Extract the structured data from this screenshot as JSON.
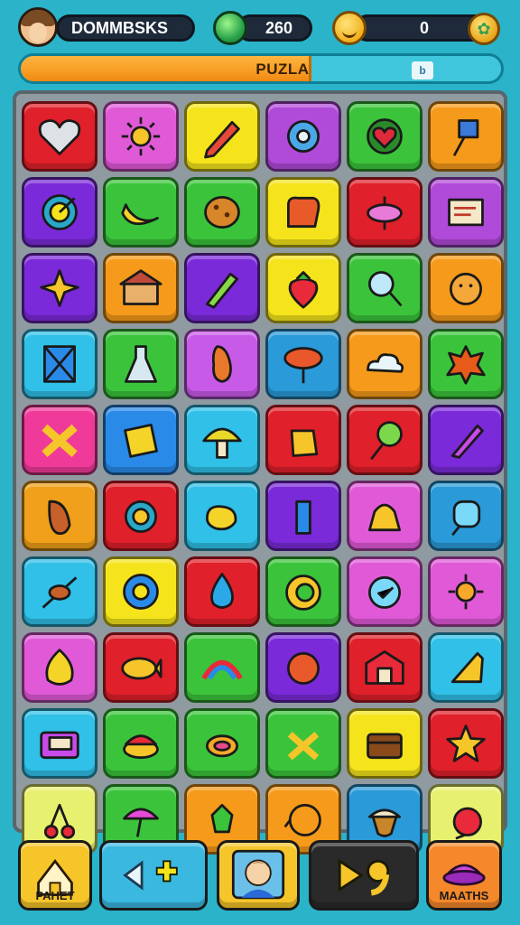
{
  "hud": {
    "player_name": "DOMMBSKS",
    "gems": "260",
    "coins": "0",
    "progress_label": "PUZLA",
    "progress_fraction": 0.6,
    "progress_chip": "b"
  },
  "board": {
    "tiles": [
      {
        "icon": "heart-shield-icon",
        "bg": "#e0202a"
      },
      {
        "icon": "sun-icon",
        "bg": "#e05ad8"
      },
      {
        "icon": "pen-icon",
        "bg": "#f5e41c"
      },
      {
        "icon": "gear-icon",
        "bg": "#b04ad8"
      },
      {
        "icon": "heart-leaf-icon",
        "bg": "#3bc43b"
      },
      {
        "icon": "tool-icon",
        "bg": "#f59a1a"
      },
      {
        "icon": "target-icon",
        "bg": "#7a2ad8"
      },
      {
        "icon": "banana-icon",
        "bg": "#3bc43b"
      },
      {
        "icon": "cookie-icon",
        "bg": "#3bc43b"
      },
      {
        "icon": "glove-icon",
        "bg": "#f5e41c"
      },
      {
        "icon": "spinner-icon",
        "bg": "#e0202a"
      },
      {
        "icon": "note-icon",
        "bg": "#b04ad8"
      },
      {
        "icon": "star-fish-icon",
        "bg": "#7a2ad8"
      },
      {
        "icon": "house-icon",
        "bg": "#f59a1a"
      },
      {
        "icon": "pencil-icon",
        "bg": "#7a2ad8"
      },
      {
        "icon": "strawberry-icon",
        "bg": "#f5e41c"
      },
      {
        "icon": "magnifier-icon",
        "bg": "#3bc43b"
      },
      {
        "icon": "turtle-icon",
        "bg": "#f59a1a"
      },
      {
        "icon": "frame-icon",
        "bg": "#30c0e8"
      },
      {
        "icon": "flask-icon",
        "bg": "#3bc43b"
      },
      {
        "icon": "bowling-icon",
        "bg": "#c85ae8"
      },
      {
        "icon": "tree-icon",
        "bg": "#2a9ad8"
      },
      {
        "icon": "cloud-icon",
        "bg": "#f59a1a"
      },
      {
        "icon": "splash-icon",
        "bg": "#3bc43b"
      },
      {
        "icon": "cross-icon",
        "bg": "#f03a9a"
      },
      {
        "icon": "puzzle-piece-icon",
        "bg": "#2a8ae8"
      },
      {
        "icon": "mushroom-icon",
        "bg": "#30c0e8"
      },
      {
        "icon": "box-icon",
        "bg": "#e0202a"
      },
      {
        "icon": "lollipop-icon",
        "bg": "#e0202a"
      },
      {
        "icon": "brush-icon",
        "bg": "#7a2ad8"
      },
      {
        "icon": "bread-icon",
        "bg": "#f0a01a"
      },
      {
        "icon": "rocket-icon",
        "bg": "#e0202a"
      },
      {
        "icon": "duck-icon",
        "bg": "#30c0e8"
      },
      {
        "icon": "bottle-icon",
        "bg": "#7a2ad8"
      },
      {
        "icon": "bell-icon",
        "bg": "#e05ad8"
      },
      {
        "icon": "popsicle-icon",
        "bg": "#2a9ad8"
      },
      {
        "icon": "kebab-icon",
        "bg": "#30c0e8"
      },
      {
        "icon": "cog-icon",
        "bg": "#f5e41c"
      },
      {
        "icon": "drop-icon",
        "bg": "#e0202a"
      },
      {
        "icon": "leaf-icon",
        "bg": "#3bc43b"
      },
      {
        "icon": "clock-icon",
        "bg": "#e05ad8"
      },
      {
        "icon": "sun-flower-icon",
        "bg": "#e05ad8"
      },
      {
        "icon": "lemon-icon",
        "bg": "#e05ad8"
      },
      {
        "icon": "fish-icon",
        "bg": "#e0202a"
      },
      {
        "icon": "rainbow-icon",
        "bg": "#3bc43b"
      },
      {
        "icon": "ball-icon",
        "bg": "#7a2ad8"
      },
      {
        "icon": "barn-icon",
        "bg": "#e0202a"
      },
      {
        "icon": "ruler-icon",
        "bg": "#30c0e8"
      },
      {
        "icon": "radio-icon",
        "bg": "#30c0e8"
      },
      {
        "icon": "cake-icon",
        "bg": "#3bc43b"
      },
      {
        "icon": "ring-icon",
        "bg": "#3bc43b"
      },
      {
        "icon": "wrench-icon",
        "bg": "#3bc43b"
      },
      {
        "icon": "chest-icon",
        "bg": "#f5e41c"
      },
      {
        "icon": "star-icon",
        "bg": "#e0202a"
      },
      {
        "icon": "cherries-icon",
        "bg": "#e8f070"
      },
      {
        "icon": "umbrella-icon",
        "bg": "#3bc43b"
      },
      {
        "icon": "frog-icon",
        "bg": "#f59a1a"
      },
      {
        "icon": "orange-icon",
        "bg": "#f59a1a"
      },
      {
        "icon": "acorn-icon",
        "bg": "#2a9ad8"
      },
      {
        "icon": "apple-icon",
        "bg": "#e8f070"
      }
    ]
  },
  "nav": {
    "home_label": "PAHET",
    "matches_label": "MAATHS",
    "home_bg": "#f5c52a",
    "arrows_bg": "#3ab8e0",
    "profile_bg": "#f5c52a",
    "play_bg": "#2a2a2a",
    "matches_bg": "#f5882a"
  }
}
